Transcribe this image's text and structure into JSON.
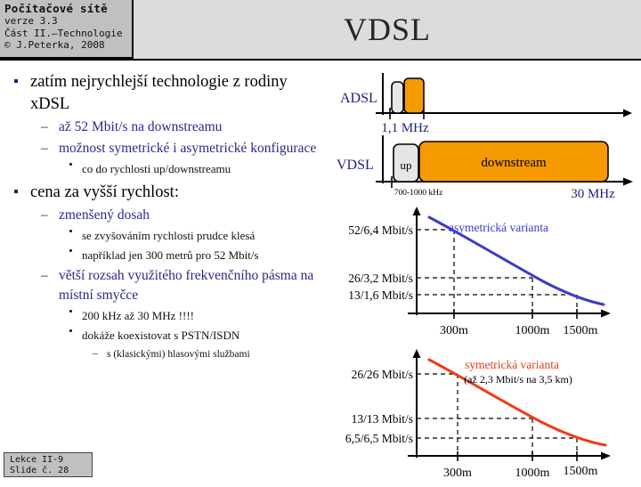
{
  "header": {
    "course_title": "Počítačové sítě",
    "version": "verze 3.3",
    "part": "Část II.–Technologie",
    "copyright": "© J.Peterka, 2008",
    "slide_title": "VDSL"
  },
  "footer": {
    "lecture": "Lekce II-9",
    "slide_number": "Slide č. 28"
  },
  "bullets": [
    {
      "level": 1,
      "marker": "•",
      "text": "zatím nejrychlejší technologie z rodiny xDSL"
    },
    {
      "level": 2,
      "marker": "–",
      "text": "až 52 Mbit/s na downstreamu"
    },
    {
      "level": 2,
      "marker": "–",
      "text": "možnost symetrické i asymetrické konfigurace"
    },
    {
      "level": 3,
      "marker": "•",
      "text": "co do rychlosti up/downstreamu"
    },
    {
      "level": 1,
      "marker": "•",
      "text": "cena za vyšší rychlost:"
    },
    {
      "level": 2,
      "marker": "–",
      "text": "zmenšený dosah"
    },
    {
      "level": 3,
      "marker": "•",
      "text": "se zvyšováním rychlosti prudce klesá"
    },
    {
      "level": 3,
      "marker": "•",
      "text": "například jen 300 metrů pro 52 Mbit/s"
    },
    {
      "level": 2,
      "marker": "–",
      "text": "větší rozsah využitého frekvenčního pásma na místní smyčce"
    },
    {
      "level": 3,
      "marker": "•",
      "text": "200 kHz až 30 MHz !!!!"
    },
    {
      "level": 3,
      "marker": "•",
      "text": "dokáže koexistovat s PSTN/ISDN"
    },
    {
      "level": 4,
      "marker": "–",
      "text": "s (klasickými) hlasovými službami"
    }
  ],
  "spectrum": {
    "adsl": {
      "label": "ADSL",
      "up_label": "",
      "down_label": "",
      "end_label": "1,1 MHz"
    },
    "vdsl": {
      "label": "VDSL",
      "up_label": "up",
      "down_label": "downstream",
      "start_label": "700-1000 kHz",
      "end_label": "30 MHz"
    },
    "colors": {
      "upstream": "#e6e6e6",
      "downstream": "#f59a00",
      "outline": "#000000",
      "axis": "#000000"
    }
  },
  "chart_data": [
    {
      "type": "line",
      "title": "asymetrická varianta",
      "subtitle": "",
      "series_color": "#3c3cc8",
      "xlabel": "",
      "ylabel": "",
      "categories": [
        "300m",
        "1000m",
        "1500m"
      ],
      "x": [
        300,
        1000,
        1500
      ],
      "ytick_labels": [
        "52/6,4 Mbit/s",
        "26/3,2 Mbit/s",
        "13/1,6 Mbit/s"
      ],
      "values": [
        52,
        26,
        13
      ],
      "upstream_values": [
        6.4,
        3.2,
        1.6
      ],
      "grid": "dashed-guides",
      "legend": "annotation-top-right"
    },
    {
      "type": "line",
      "title": "symetrická varianta",
      "subtitle": "(až 2,3 Mbit/s na 3,5 km)",
      "series_color": "#ef3b18",
      "xlabel": "",
      "ylabel": "",
      "categories": [
        "300m",
        "1000m",
        "1500m"
      ],
      "x": [
        300,
        1000,
        1500
      ],
      "ytick_labels": [
        "26/26 Mbit/s",
        "13/13 Mbit/s",
        "6,5/6,5 Mbit/s"
      ],
      "values": [
        26,
        13,
        6.5
      ],
      "upstream_values": [
        26,
        13,
        6.5
      ],
      "grid": "dashed-guides",
      "legend": "annotation-top-right"
    }
  ]
}
